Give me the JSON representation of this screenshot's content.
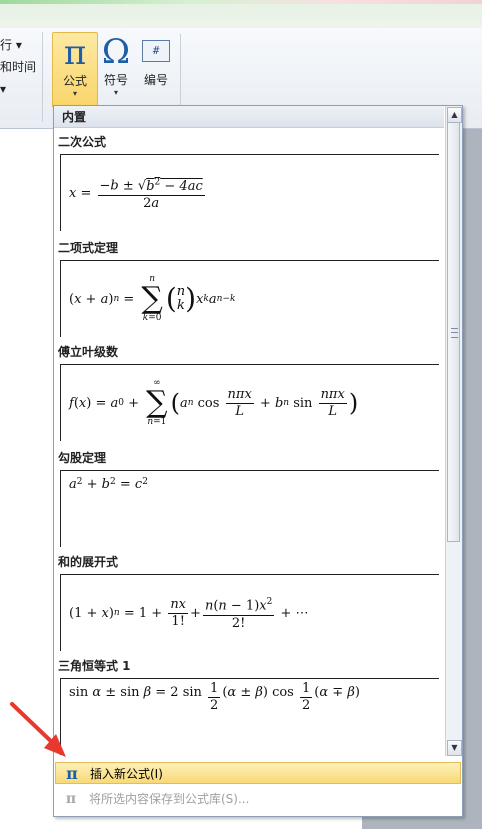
{
  "ribbon": {
    "left_items": [
      "行 ▾",
      "和时间",
      "▾"
    ],
    "buttons": [
      {
        "icon": "pi-icon",
        "glyph": "π",
        "label": "公式",
        "arrow": "▾"
      },
      {
        "icon": "omega-icon",
        "glyph": "Ω",
        "label": "符号",
        "arrow": "▾"
      },
      {
        "icon": "numbering-icon",
        "glyph": "#",
        "label": "编号"
      }
    ]
  },
  "dropdown": {
    "header": "内置",
    "equations": [
      {
        "name": "二次公式"
      },
      {
        "name": "二项式定理"
      },
      {
        "name": "傅立叶级数"
      },
      {
        "name": "勾股定理"
      },
      {
        "name": "和的展开式"
      },
      {
        "name": "三角恒等式 1"
      }
    ],
    "menu": [
      {
        "icon": "pi-icon",
        "glyph": "π",
        "label": "插入新公式(I)",
        "enabled": true,
        "highlighted": true
      },
      {
        "icon": "save-to-gallery-icon",
        "glyph": "π",
        "label": "将所选内容保存到公式库(S)...",
        "enabled": false
      }
    ]
  },
  "scrollbar": {
    "up": "▲",
    "down": "▼"
  },
  "colors": {
    "accent": "#1e5ea8",
    "highlight": "#f8d978",
    "arrow": "#e8392e"
  }
}
